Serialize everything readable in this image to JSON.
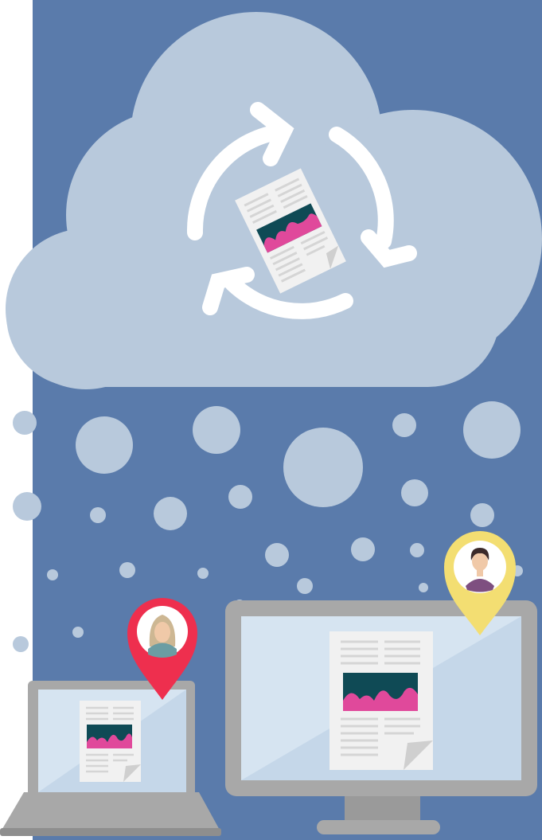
{
  "illustration": {
    "subject": "cloud-document-sync",
    "icons": [
      "cloud-icon",
      "sync-arrows-icon",
      "document-icon",
      "laptop-icon",
      "monitor-icon",
      "location-pin-icon",
      "user-avatar-icon"
    ]
  },
  "colors": {
    "page_background": "#ffffff",
    "panel": "#5a7bab",
    "cloud": "#b8c9dc",
    "bubble": "#b8c9dc",
    "sync_arrows": "#ffffff",
    "device_frame": "#a8a8a8",
    "device_frame_dark": "#8e8e8e",
    "screen": "#d6e4f1",
    "screen_shadow": "#c5d7e9",
    "document": "#f1f1f1",
    "document_fold": "#cfcfcf",
    "document_lines": "#d5d5d5",
    "chart_bg": "#0f4a55",
    "chart_wave": "#e0499b",
    "pin_red": "#ee2f4e",
    "pin_yellow": "#f3de72",
    "avatar_bg": "#ffffff",
    "skin": "#f0c9a8",
    "hair_blonde": "#cdb793",
    "hair_dark": "#3b2a2a",
    "shirt_teal": "#6b9da3",
    "shirt_purple": "#7e4f80"
  }
}
